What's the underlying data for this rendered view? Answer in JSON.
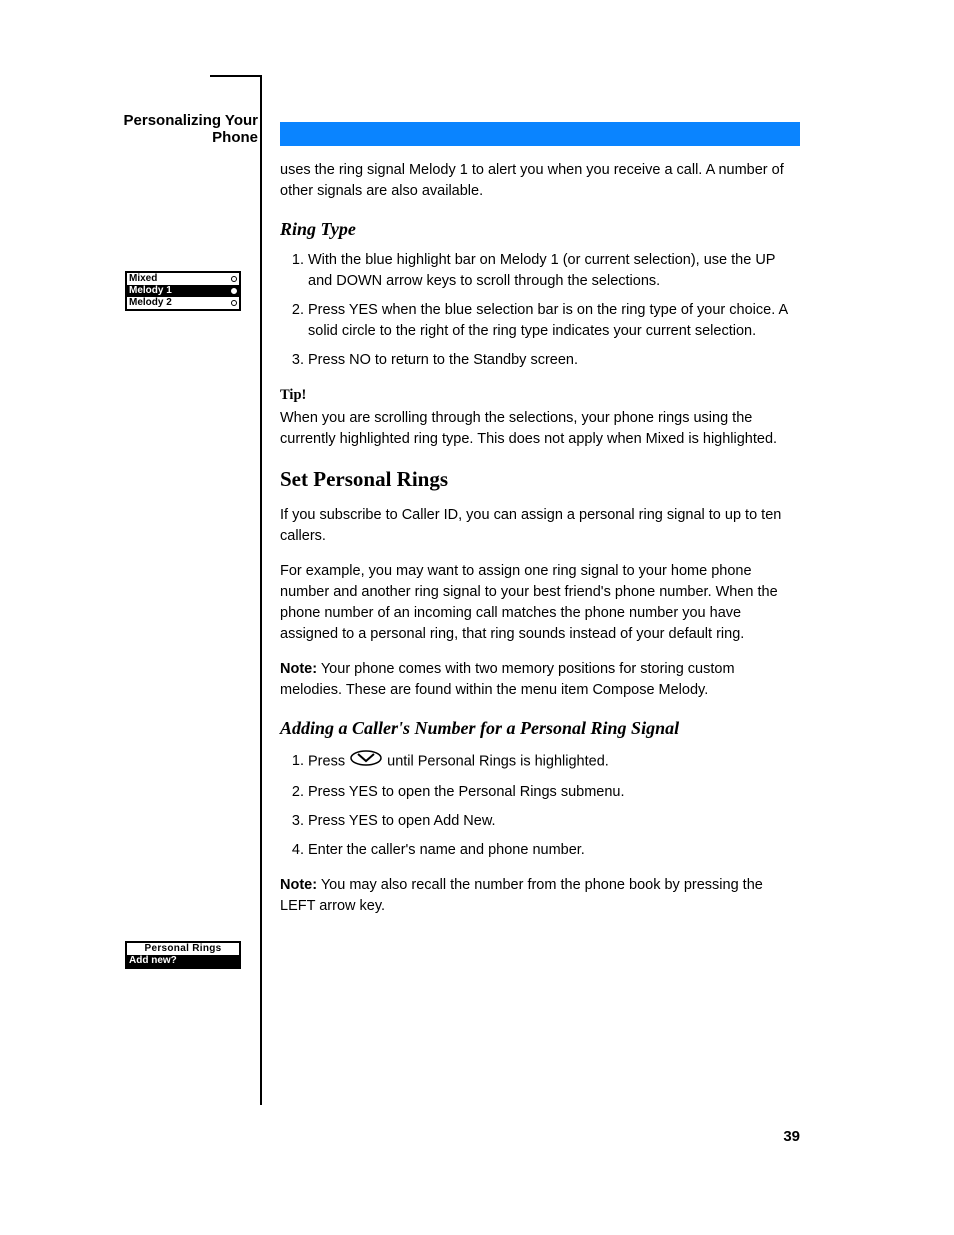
{
  "running_title": "Personalizing Your Phone",
  "blue_band_aria": "section header bar",
  "intro_1": "uses the ring signal Melody 1 to alert you when you receive a call. A number of other signals are also available.",
  "ring_type": {
    "heading": "Ring Type",
    "steps": [
      "With the blue highlight bar on Melody 1 (or current selection), use the UP and DOWN arrow keys to scroll through the selections.",
      "Press YES when the blue selection bar is on the ring type of your choice. A solid circle to the right of the ring type indicates your current selection.",
      "Press NO to return to the Standby screen."
    ],
    "tip_label": "Tip!",
    "tip": "When you are scrolling through the selections, your phone rings using the currently highlighted ring type. This does not apply when Mixed is highlighted."
  },
  "personal_rings": {
    "heading": "Set Personal Rings",
    "intro": "If you subscribe to Caller ID, you can assign a personal ring signal to up to ten callers.",
    "example": "For example, you may want to assign one ring signal to your home phone number and another ring signal to your best friend's phone number. When the phone number of an incoming call matches the phone number you have assigned to a personal ring, that ring sounds instead of your default ring.",
    "note_label": "Note:",
    "note": "Your phone comes with two memory positions for storing custom melodies. These are found within the menu item Compose Melody.",
    "sub_heading": "Adding a Caller's Number for a Personal Ring Signal",
    "steps": [
      {
        "text_a": "Press ",
        "text_b": " until Personal Rings is highlighted."
      },
      {
        "text_a": "Press YES to open the Personal Rings submenu."
      },
      {
        "text_a": "Press YES to open Add New."
      },
      {
        "text_a": "Enter the caller's name and phone number."
      }
    ],
    "note2_label": "Note:",
    "note2": "You may also recall the number from the phone book by pressing the LEFT arrow key."
  },
  "lcd1": {
    "rows": [
      {
        "label": "Mixed",
        "selected": false,
        "active": false
      },
      {
        "label": "Melody 1",
        "selected": true,
        "active": true
      },
      {
        "label": "Melody 2",
        "selected": false,
        "active": false
      }
    ]
  },
  "lcd2": {
    "title": "Personal Rings",
    "row": "Add new?"
  },
  "yes_key_aria": "YES navigation key icon",
  "page_number": "39"
}
